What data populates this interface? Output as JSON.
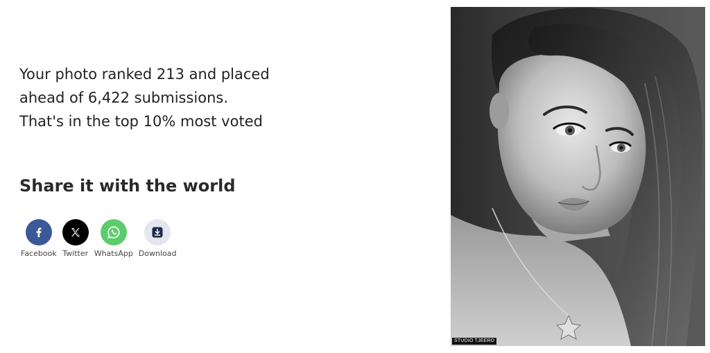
{
  "result": {
    "line1": "Your photo ranked 213 and placed",
    "line2": "ahead of 6,422 submissions.",
    "line3": "That's in the top 10% most voted"
  },
  "share": {
    "title": "Share it with the world",
    "buttons": [
      {
        "label": "Facebook",
        "icon": "facebook-icon",
        "color": "#3b5998"
      },
      {
        "label": "Twitter",
        "icon": "x-twitter-icon",
        "color": "#000000"
      },
      {
        "label": "WhatsApp",
        "icon": "whatsapp-icon",
        "color": "#5ccd6c"
      },
      {
        "label": "Download",
        "icon": "download-icon",
        "color": "#e3e6ee"
      }
    ]
  },
  "photo": {
    "watermark": "STUDIO TJEERD"
  }
}
